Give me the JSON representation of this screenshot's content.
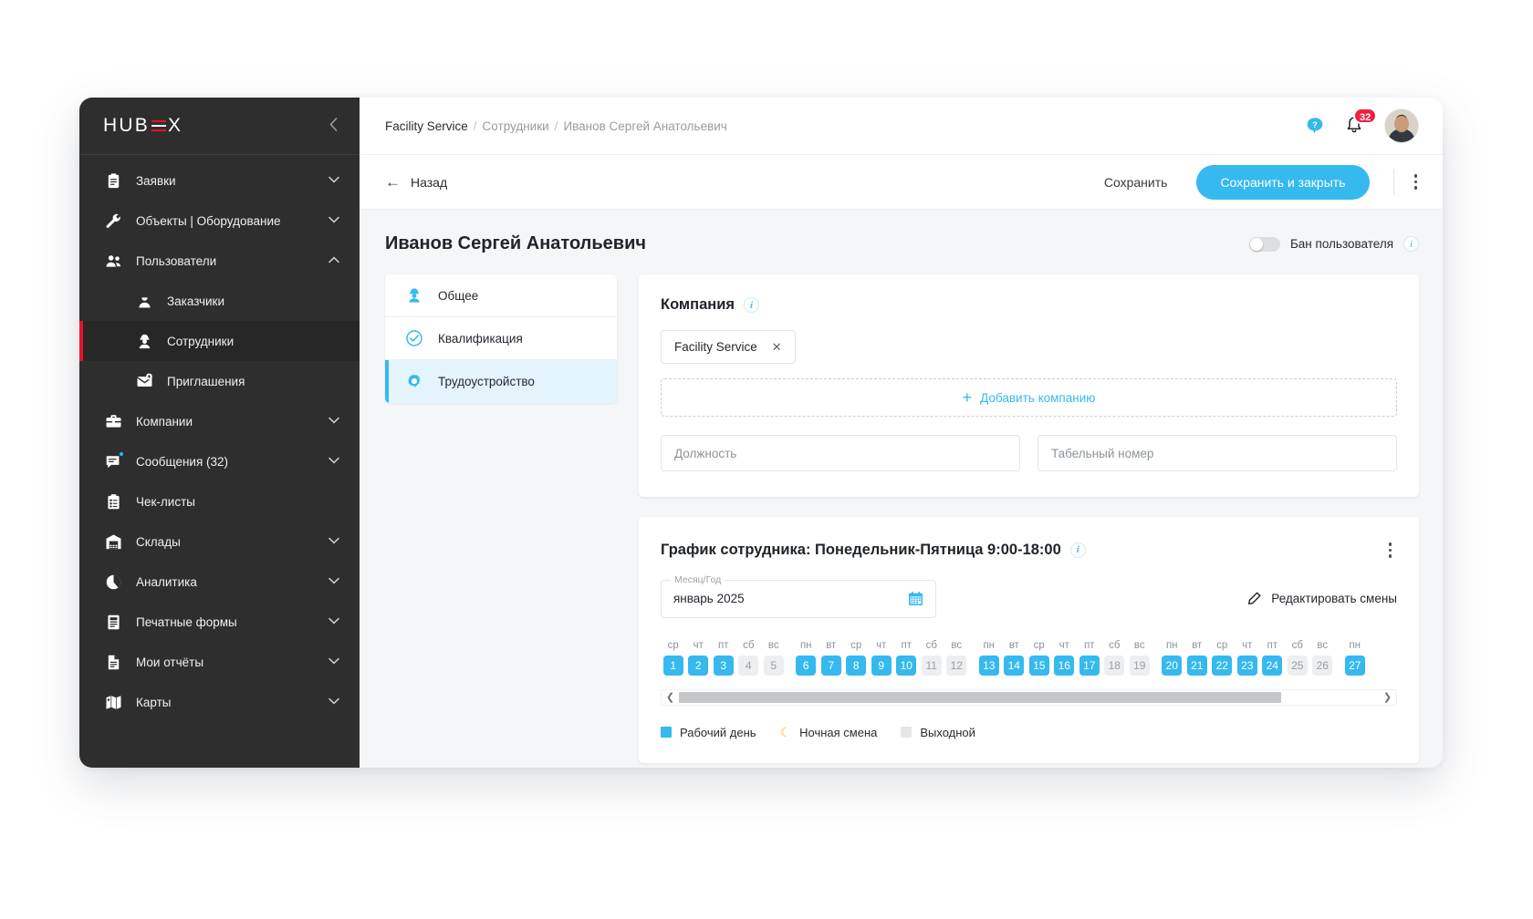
{
  "sidebar": {
    "logo": {
      "part1": "H",
      "part2": "UB",
      "part3": "X"
    },
    "collapse_icon": "chevron-left-icon",
    "items": [
      {
        "label": "Заявки",
        "icon": "clipboard-icon",
        "chevron": "⌄",
        "level": 0,
        "active": false
      },
      {
        "label": "Объекты | Оборудование",
        "icon": "wrench-icon",
        "chevron": "⌄",
        "level": 0,
        "active": false
      },
      {
        "label": "Пользователи",
        "icon": "users-icon",
        "chevron": "⌃",
        "level": 0,
        "active": false
      },
      {
        "label": "Заказчики",
        "icon": "customer-icon",
        "chevron": "",
        "level": 1,
        "active": false
      },
      {
        "label": "Сотрудники",
        "icon": "employee-icon",
        "chevron": "",
        "level": 1,
        "active": true
      },
      {
        "label": "Приглашения",
        "icon": "invite-icon",
        "chevron": "",
        "level": 1,
        "active": false
      },
      {
        "label": "Компании",
        "icon": "briefcase-icon",
        "chevron": "⌄",
        "level": 0,
        "active": false
      },
      {
        "label": "Сообщения (32)",
        "icon": "message-icon",
        "chevron": "⌄",
        "level": 0,
        "active": false,
        "dot": true
      },
      {
        "label": "Чек-листы",
        "icon": "checklist-icon",
        "chevron": "",
        "level": 0,
        "active": false
      },
      {
        "label": "Склады",
        "icon": "warehouse-icon",
        "chevron": "⌄",
        "level": 0,
        "active": false
      },
      {
        "label": "Аналитика",
        "icon": "piechart-icon",
        "chevron": "⌄",
        "level": 0,
        "active": false
      },
      {
        "label": "Печатные формы",
        "icon": "printform-icon",
        "chevron": "⌄",
        "level": 0,
        "active": false
      },
      {
        "label": "Мои отчёты",
        "icon": "report-icon",
        "chevron": "⌄",
        "level": 0,
        "active": false
      },
      {
        "label": "Карты",
        "icon": "map-icon",
        "chevron": "⌄",
        "level": 0,
        "active": false
      }
    ]
  },
  "topbar": {
    "breadcrumb": {
      "root": "Facility Service",
      "middle": "Сотрудники",
      "current": "Иванов Сергей Анатольевич",
      "separator": "/"
    },
    "help_icon": "help-bubble-icon",
    "bell_icon": "bell-icon",
    "notification_count": "32",
    "avatar": "user-avatar"
  },
  "actionbar": {
    "back_label": "Назад",
    "back_icon": "arrow-left-icon",
    "save_label": "Сохранить",
    "save_close_label": "Сохранить и закрыть",
    "more_icon": "kebab-menu-icon"
  },
  "page": {
    "title": "Иванов Сергей Анатольевич",
    "ban_label": "Бан пользователя",
    "ban_enabled": false,
    "ban_info_icon": "info-icon"
  },
  "tabs": [
    {
      "label": "Общее",
      "icon": "profile-icon",
      "active": false
    },
    {
      "label": "Квалификация",
      "icon": "check-circle-icon",
      "active": false
    },
    {
      "label": "Трудоустройство",
      "icon": "gear-icon",
      "active": true
    }
  ],
  "company_card": {
    "title": "Компания",
    "info_icon": "info-icon",
    "chip": {
      "label": "Facility Service",
      "remove_icon": "close-icon"
    },
    "add_label": "Добавить компанию",
    "add_icon": "plus-icon",
    "position_placeholder": "Должность",
    "position_value": "",
    "number_placeholder": "Табельный номер",
    "number_value": ""
  },
  "schedule_card": {
    "title": "График сотрудника: Понедельник-Пятница 9:00-18:00",
    "info_icon": "info-icon",
    "more_icon": "kebab-menu-icon",
    "month_legend": "Месяц/Год",
    "month_value": "январь 2025",
    "calendar_icon": "calendar-icon",
    "edit_label": "Редактировать смены",
    "edit_icon": "pencil-icon",
    "scroll_left_icon": "chevron-left-icon",
    "scroll_right_icon": "chevron-right-icon",
    "legend": [
      {
        "label": "Рабочий день",
        "swatch": "blue"
      },
      {
        "label": "Ночная смена",
        "swatch": "moon"
      },
      {
        "label": "Выходной",
        "swatch": "grey"
      }
    ],
    "colors": {
      "work": "#35b9ef",
      "off": "#e4e6e9",
      "night": "#fbc02d"
    },
    "days": [
      {
        "dow": "ср",
        "num": "1",
        "type": "work"
      },
      {
        "dow": "чт",
        "num": "2",
        "type": "work"
      },
      {
        "dow": "пт",
        "num": "3",
        "type": "work"
      },
      {
        "dow": "сб",
        "num": "4",
        "type": "off"
      },
      {
        "dow": "вс",
        "num": "5",
        "type": "off"
      },
      {
        "dow": "пн",
        "num": "6",
        "type": "work"
      },
      {
        "dow": "вт",
        "num": "7",
        "type": "work"
      },
      {
        "dow": "ср",
        "num": "8",
        "type": "work"
      },
      {
        "dow": "чт",
        "num": "9",
        "type": "work"
      },
      {
        "dow": "пт",
        "num": "10",
        "type": "work"
      },
      {
        "dow": "сб",
        "num": "11",
        "type": "off"
      },
      {
        "dow": "вс",
        "num": "12",
        "type": "off"
      },
      {
        "dow": "пн",
        "num": "13",
        "type": "work"
      },
      {
        "dow": "вт",
        "num": "14",
        "type": "work"
      },
      {
        "dow": "ср",
        "num": "15",
        "type": "work"
      },
      {
        "dow": "чт",
        "num": "16",
        "type": "work"
      },
      {
        "dow": "пт",
        "num": "17",
        "type": "work"
      },
      {
        "dow": "сб",
        "num": "18",
        "type": "off"
      },
      {
        "dow": "вс",
        "num": "19",
        "type": "off"
      },
      {
        "dow": "пн",
        "num": "20",
        "type": "work"
      },
      {
        "dow": "вт",
        "num": "21",
        "type": "work"
      },
      {
        "dow": "ср",
        "num": "22",
        "type": "work"
      },
      {
        "dow": "чт",
        "num": "23",
        "type": "work"
      },
      {
        "dow": "пт",
        "num": "24",
        "type": "work"
      },
      {
        "dow": "сб",
        "num": "25",
        "type": "off"
      },
      {
        "dow": "вс",
        "num": "26",
        "type": "off"
      },
      {
        "dow": "пн",
        "num": "27",
        "type": "work"
      }
    ]
  }
}
